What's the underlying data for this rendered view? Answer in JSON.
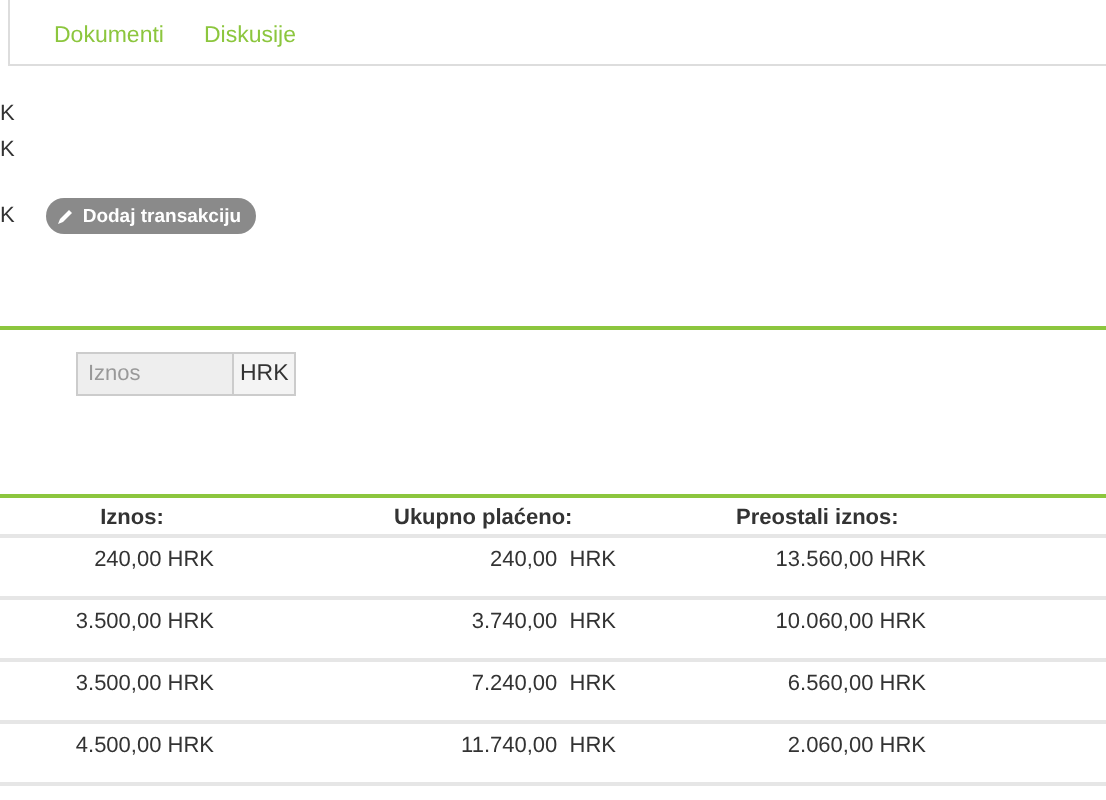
{
  "tabs": [
    {
      "label": "Dokumenti",
      "selected": false
    },
    {
      "label": "Diskusije",
      "selected": false
    }
  ],
  "summary_lines": [
    "K",
    "K",
    "K"
  ],
  "add_button": "Dodaj transakciju",
  "amount_field": {
    "placeholder": "Iznos",
    "addon": "HRK"
  },
  "table": {
    "columns": [
      "Iznos:",
      "Ukupno plaćeno:",
      "Preostali iznos:"
    ],
    "rows": [
      [
        "240,00 HRK",
        "240,00  HRK",
        "13.560,00 HRK"
      ],
      [
        "3.500,00 HRK",
        "3.740,00  HRK",
        "10.060,00 HRK"
      ],
      [
        "3.500,00 HRK",
        "7.240,00  HRK",
        "6.560,00 HRK"
      ],
      [
        "4.500,00 HRK",
        "11.740,00  HRK",
        "2.060,00 HRK"
      ]
    ]
  }
}
